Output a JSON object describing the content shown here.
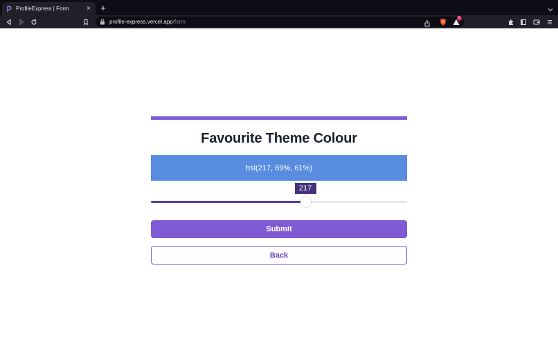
{
  "browser": {
    "tab": {
      "title": "ProfileExpress | Form",
      "favicon": "profile-express-logo-icon"
    },
    "url": {
      "host": "profile-express.vercel.app",
      "path": "/form"
    },
    "rewards_badge": "6",
    "colors": {
      "chrome_dark": "#0d0e15",
      "chrome_bar": "#1f2028",
      "brave_orange": "#fb542b"
    }
  },
  "page": {
    "heading": "Favourite Theme Colour",
    "swatch": {
      "label": "hsl(217, 69%, 61%)",
      "color": "hsl(217, 69%, 61%)"
    },
    "slider": {
      "value": 217,
      "min": 0,
      "max": 360,
      "label": "217"
    },
    "submit_label": "Submit",
    "back_label": "Back",
    "colors": {
      "accent": "#805ad5",
      "heading": "#1a202c",
      "slider_fill": "#553c9a",
      "tooltip": "#44337a"
    }
  }
}
